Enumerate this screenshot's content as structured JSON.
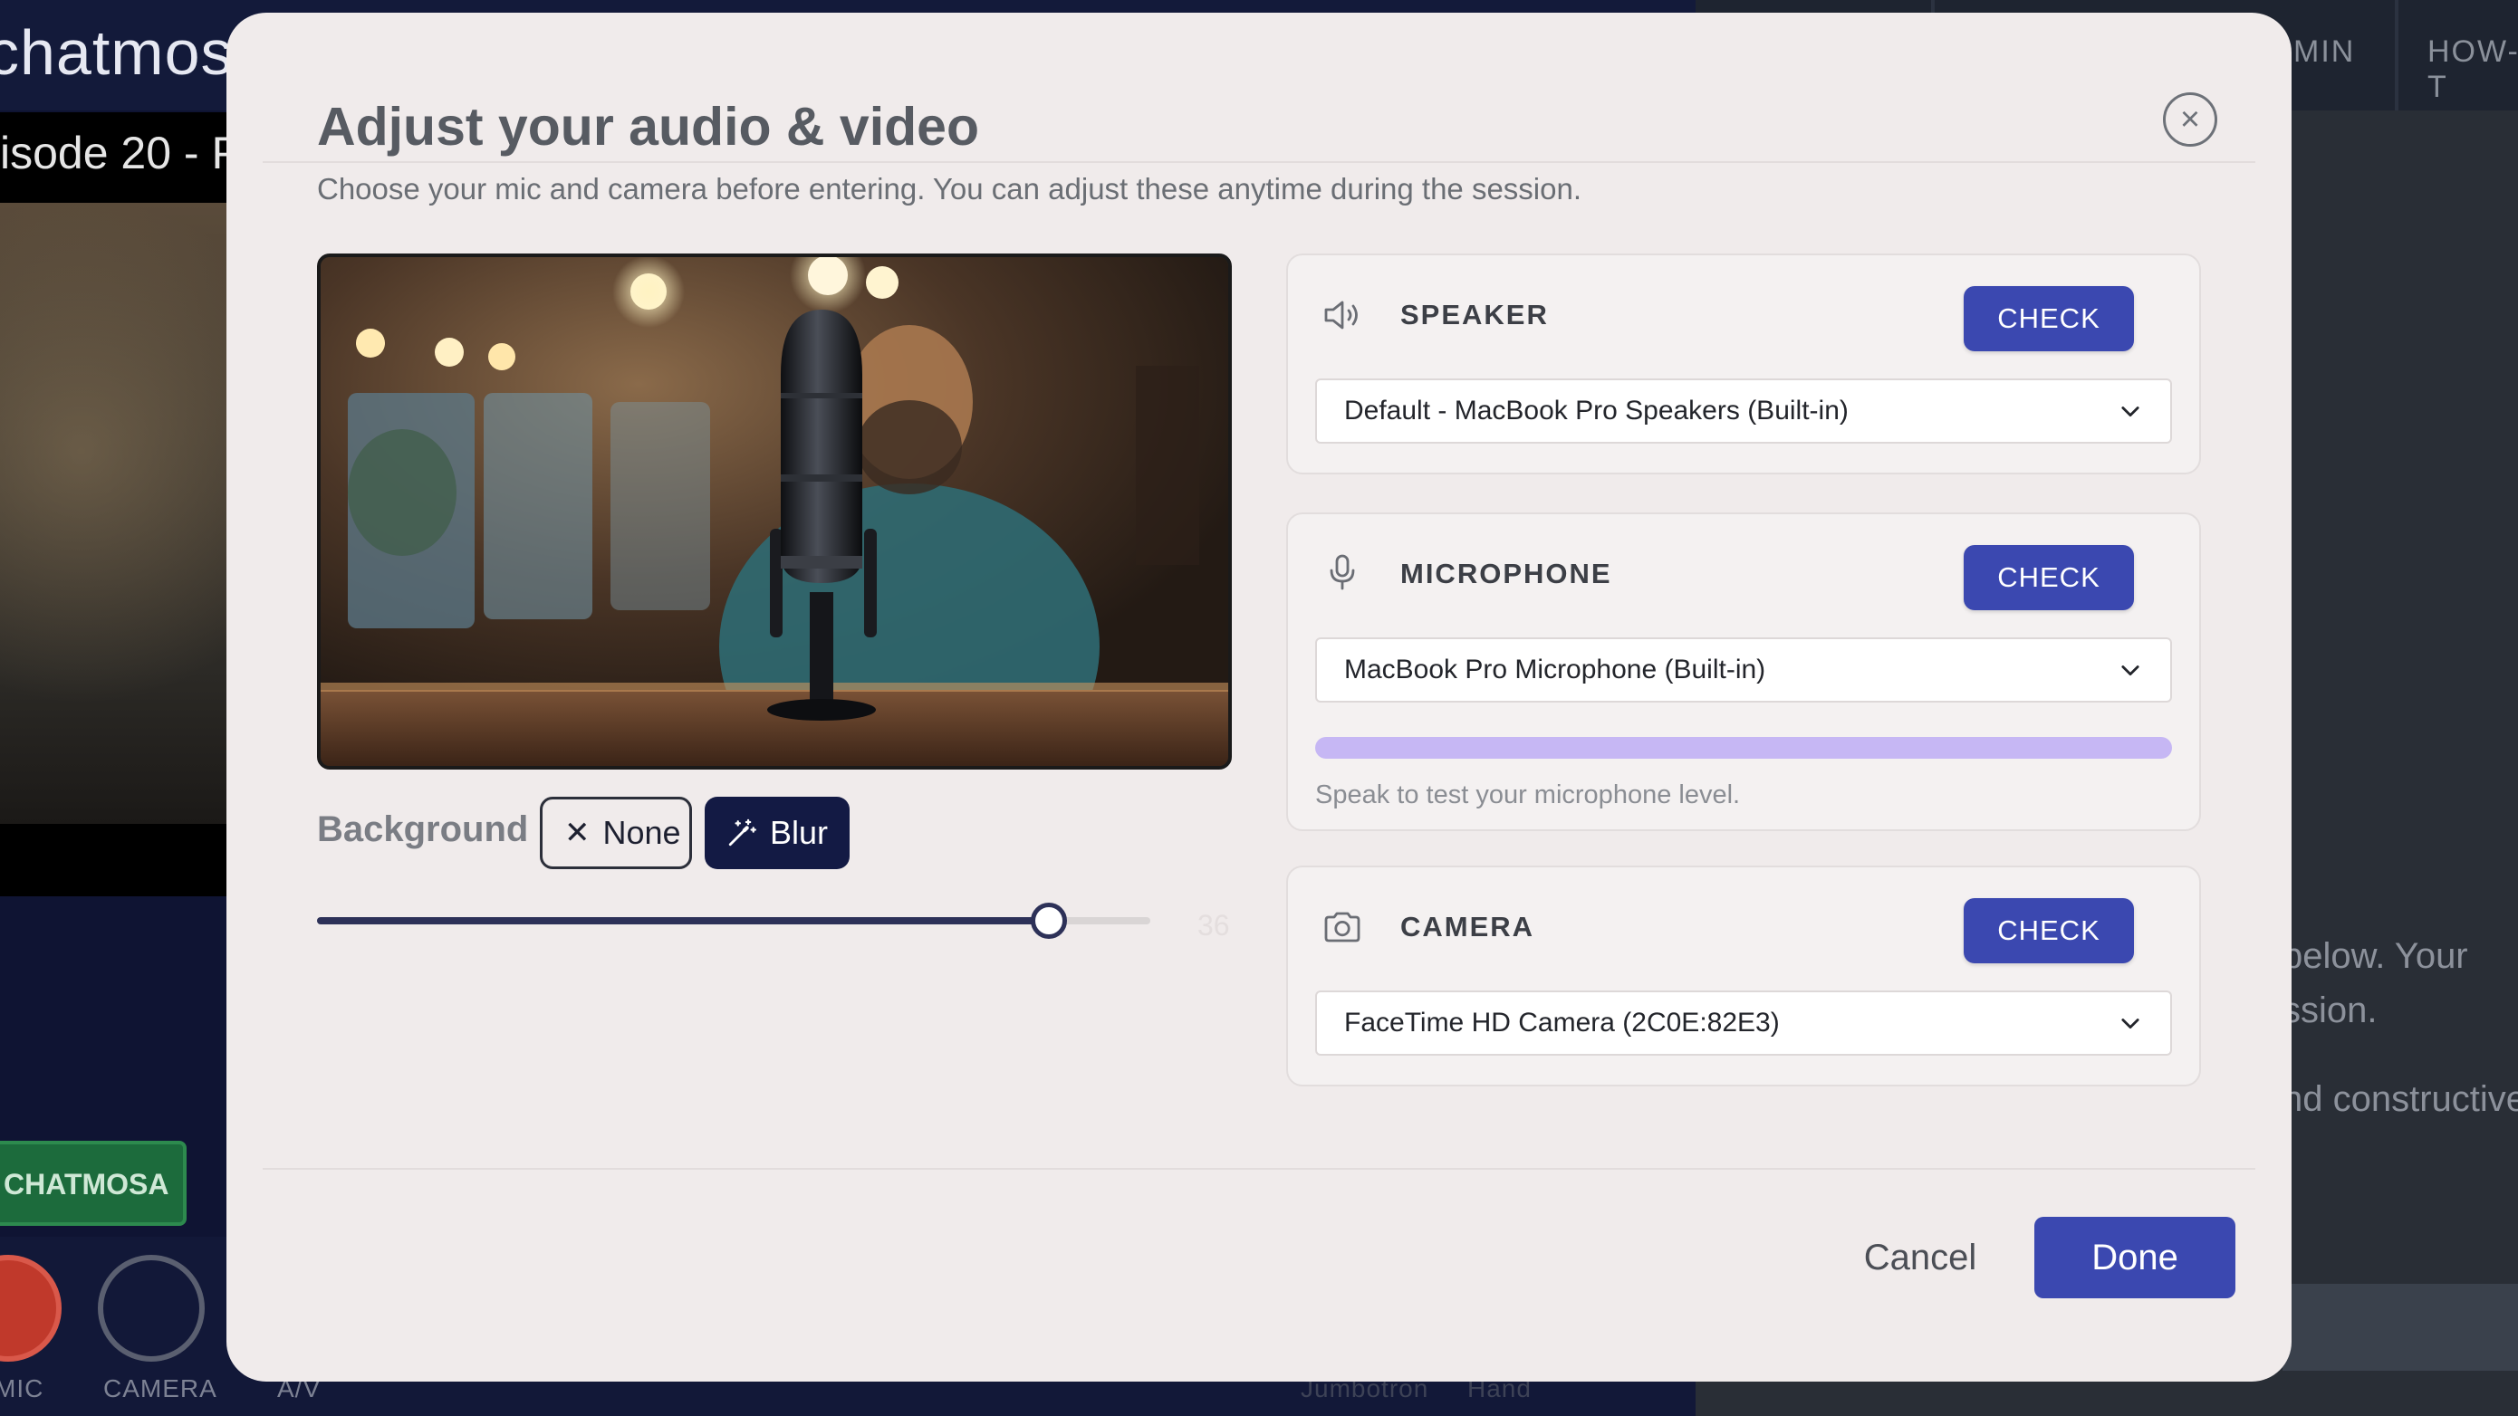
{
  "background_app": {
    "logo": "chatmosa",
    "episode_title": "isode 20 - P",
    "nav_tabs": [
      "MIN",
      "HOW-T"
    ],
    "right_text": [
      "below. Your",
      "ssion.",
      "nd constructive"
    ],
    "chat_button": "CHATMOSA",
    "bottom_labels": [
      "MIC",
      "CAMERA",
      "A/V",
      "Jumbotron",
      "Hand"
    ]
  },
  "modal": {
    "title": "Adjust your audio & video",
    "subtitle": "Choose your mic and camera before entering. You can adjust these anytime during the session.",
    "close_icon": "close-icon",
    "background": {
      "label": "Background",
      "options": [
        {
          "label": "None",
          "icon": "x-icon",
          "selected": false
        },
        {
          "label": "Blur",
          "icon": "magic-wand-icon",
          "selected": true
        }
      ],
      "blur_level": 36,
      "blur_max": 41,
      "blur_value_text": "36"
    },
    "speaker": {
      "title": "SPEAKER",
      "icon": "speaker-icon",
      "check_label": "CHECK",
      "selected": "Default - MacBook Pro Speakers (Built-in)"
    },
    "microphone": {
      "title": "MICROPHONE",
      "icon": "microphone-icon",
      "check_label": "CHECK",
      "selected": "MacBook Pro Microphone (Built-in)",
      "hint": "Speak to test your microphone level."
    },
    "camera": {
      "title": "CAMERA",
      "icon": "camera-icon",
      "check_label": "CHECK",
      "selected": "FaceTime HD Camera (2C0E:82E3)"
    },
    "footer": {
      "cancel_label": "Cancel",
      "done_label": "Done"
    }
  },
  "colors": {
    "accent": "#3b48b0",
    "blur_selected": "#131a44",
    "level_bar": "#c6b7f4",
    "modal_bg": "#f0ebeb"
  }
}
